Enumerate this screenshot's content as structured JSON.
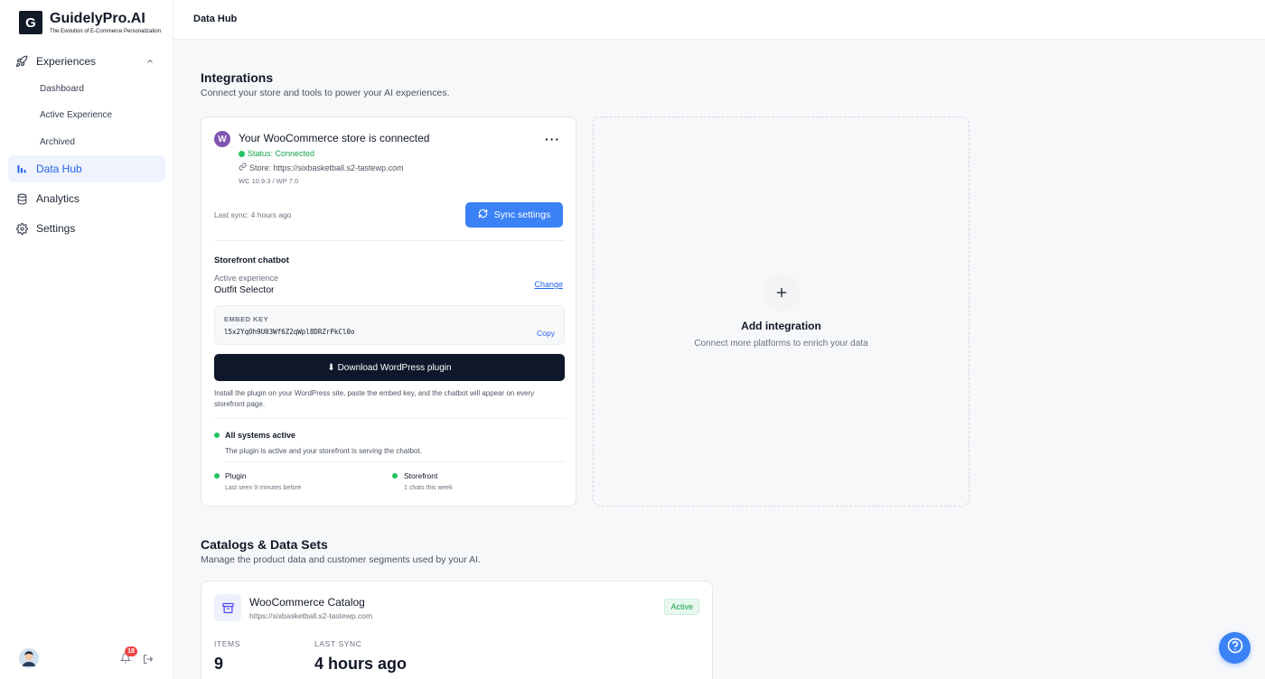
{
  "brand": {
    "logo_letter": "G",
    "name": "GuidelyPro.AI",
    "tagline": "The Evolution of E-Commerce Personalization"
  },
  "sidebar": {
    "experiences_label": "Experiences",
    "sub_items": [
      "Dashboard",
      "Active Experience",
      "Archived"
    ],
    "items": [
      {
        "label": "Data Hub",
        "icon": "bar-chart-icon",
        "active": true
      },
      {
        "label": "Analytics",
        "icon": "database-icon"
      },
      {
        "label": "Settings",
        "icon": "gear-icon"
      }
    ],
    "notification_count": "18"
  },
  "topbar": {
    "title": "Data Hub"
  },
  "integrations": {
    "title": "Integrations",
    "subtitle": "Connect your store and tools to power your AI experiences.",
    "woo": {
      "icon_letter": "W",
      "title": "Your WooCommerce store is connected",
      "status": "Status: Connected",
      "store": "Store: https://sixbasketball.s2-tastewp.com",
      "versions": "WC 10.9.3 / WP 7.0",
      "last_sync": "Last sync: 4 hours ago",
      "sync_button": "Sync settings",
      "more": "···",
      "chatbot_title": "Storefront chatbot",
      "active_label": "Active experience",
      "active_value": "Outfit Selector",
      "change_label": "Change",
      "embed_label": "EMBED KEY",
      "embed_key": "l5x2YqOh9U03Wf6Z2qWpl8DRZrPkCl0o",
      "copy_label": "Copy",
      "download_label": "⬇ Download WordPress plugin",
      "install_note": "Install the plugin on your WordPress site, paste the embed key, and the chatbot will appear on every storefront page.",
      "systems_title": "All systems active",
      "systems_sub": "The plugin is active and your storefront is serving the chatbot.",
      "plugin_title": "Plugin",
      "plugin_sub": "Last seen 9 minutes before",
      "storefront_title": "Storefront",
      "storefront_sub": "1 chats this week"
    },
    "add": {
      "title": "Add integration",
      "subtitle": "Connect more platforms to enrich your data"
    }
  },
  "catalogs": {
    "title": "Catalogs & Data Sets",
    "subtitle": "Manage the product data and customer segments used by your AI.",
    "card": {
      "title": "WooCommerce Catalog",
      "url": "https://sixbasketball.s2-tastewp.com",
      "badge": "Active",
      "items_label": "ITEMS",
      "items_value": "9",
      "sync_label": "LAST SYNC",
      "sync_value": "4 hours ago"
    }
  },
  "colors": {
    "accent": "#3b82f6",
    "success": "#22c55e",
    "dark": "#0f172a",
    "woo": "#7f54b3"
  }
}
